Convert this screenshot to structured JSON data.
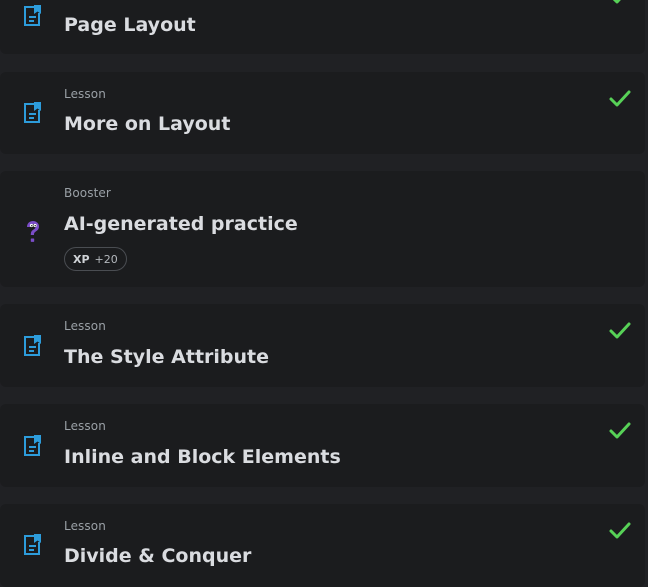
{
  "items": [
    {
      "type": "",
      "title": "Page Layout",
      "icon": "lesson-icon",
      "completed": true
    },
    {
      "type": "Lesson",
      "title": "More on Layout",
      "icon": "lesson-icon",
      "completed": true
    },
    {
      "type": "Booster",
      "title": "AI-generated practice",
      "icon": "question-mark-icon",
      "completed": false,
      "xp_label": "XP",
      "xp_value": "+20"
    },
    {
      "type": "Lesson",
      "title": "The Style Attribute",
      "icon": "lesson-icon",
      "completed": true
    },
    {
      "type": "Lesson",
      "title": "Inline and Block Elements",
      "icon": "lesson-icon",
      "completed": true
    },
    {
      "type": "Lesson",
      "title": "Divide & Conquer",
      "icon": "lesson-icon",
      "completed": true
    }
  ],
  "colors": {
    "background": "#202124",
    "card": "#1b1c1e",
    "lesson_icon": "#2d9cdb",
    "booster_icon": "#7b4dc7",
    "check": "#57d157"
  }
}
